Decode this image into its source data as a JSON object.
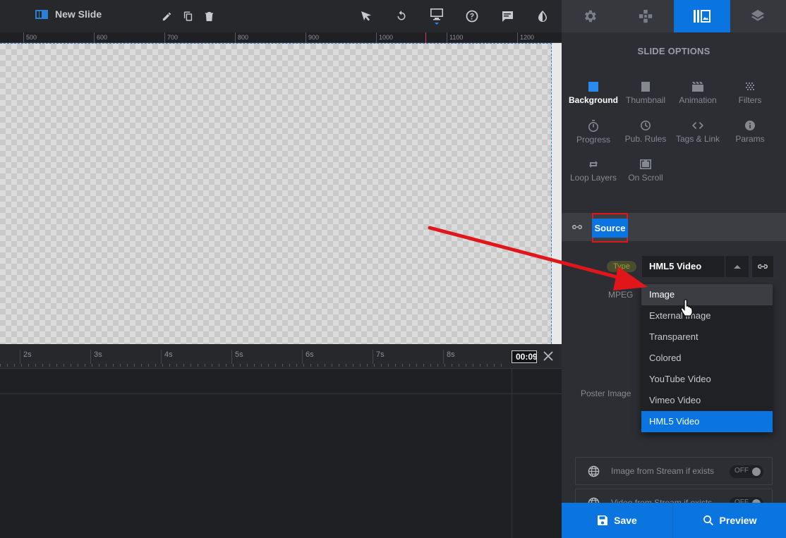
{
  "toolbar": {
    "slide_title": "New Slide",
    "icons": [
      "slide-icon",
      "edit-icon",
      "duplicate-icon",
      "delete-icon",
      "pointer-icon",
      "undo-icon",
      "desktop-icon",
      "help-icon",
      "comment-icon",
      "contrast-icon"
    ]
  },
  "ruler": {
    "ticks": [
      "500",
      "600",
      "700",
      "800",
      "900",
      "1000",
      "1100",
      "1200"
    ]
  },
  "timeline": {
    "ticks": [
      "2s",
      "3s",
      "4s",
      "5s",
      "6s",
      "7s",
      "8s"
    ],
    "current_time": "00:09"
  },
  "panel": {
    "tabs": [
      "gear-icon",
      "puzzle-icon",
      "slide-options-icon",
      "layers-icon"
    ],
    "active_tab": 2,
    "header": "SLIDE OPTIONS",
    "options": [
      {
        "label": "Background",
        "icon": "image-icon",
        "active": true
      },
      {
        "label": "Thumbnail",
        "icon": "thumbnail-icon"
      },
      {
        "label": "Animation",
        "icon": "film-icon"
      },
      {
        "label": "Filters",
        "icon": "filters-icon"
      },
      {
        "label": "Progress",
        "icon": "stopwatch-icon"
      },
      {
        "label": "Pub. Rules",
        "icon": "clock-icon"
      },
      {
        "label": "Tags & Link",
        "icon": "code-icon"
      },
      {
        "label": "Params",
        "icon": "info-icon"
      },
      {
        "label": "Loop Layers",
        "icon": "loop-icon"
      },
      {
        "label": "On Scroll",
        "icon": "on-scroll-icon"
      }
    ],
    "source": {
      "label": "Source",
      "type_label": "Type",
      "type_value": "HML5 Video",
      "mpeg_label": "MPEG",
      "poster_label": "Poster Image",
      "dropdown_options": [
        "Image",
        "External Image",
        "Transparent",
        "Colored",
        "YouTube Video",
        "Vimeo Video",
        "HML5 Video"
      ],
      "hovered_option": "Image",
      "selected_option": "HML5 Video"
    },
    "stream_rows": [
      {
        "label": "Image from Stream if exists",
        "toggle": "OFF"
      },
      {
        "label": "Video from Stream if exists",
        "toggle": "OFF"
      }
    ],
    "save_label": "Save",
    "preview_label": "Preview"
  },
  "colors": {
    "accent": "#0a74e0",
    "annotation": "#e0161b",
    "panel_bg": "#2c2e33"
  }
}
